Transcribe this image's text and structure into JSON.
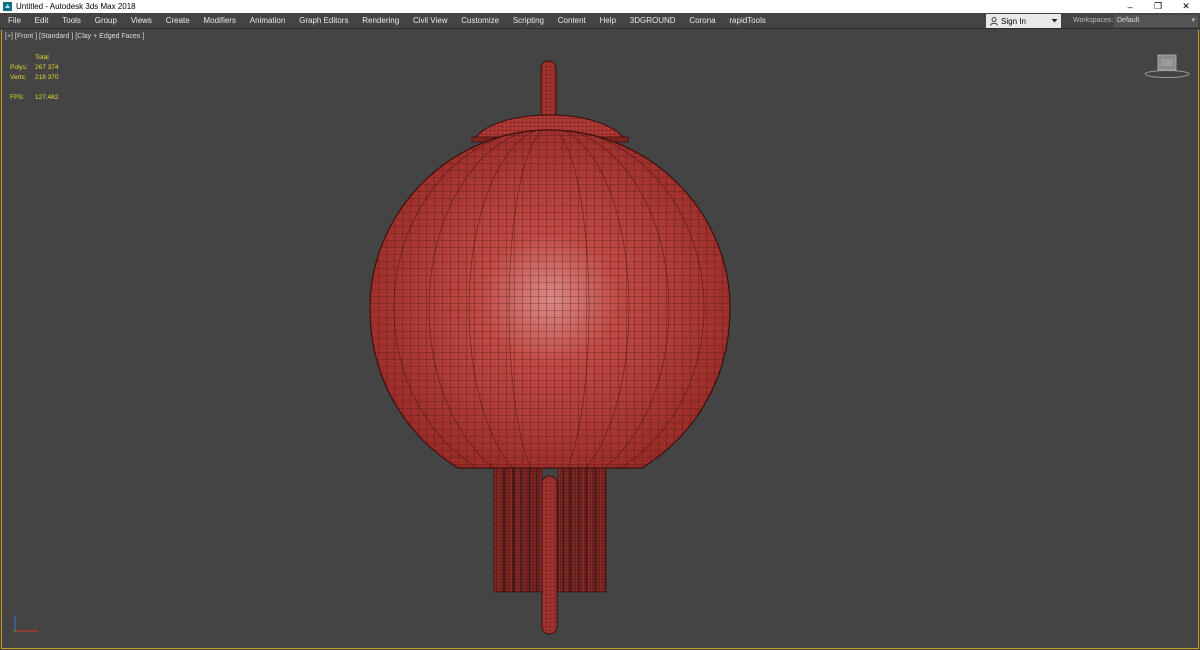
{
  "window": {
    "title": "Untitled - Autodesk 3ds Max 2018",
    "minimize_glyph": "–",
    "restore_glyph": "❐",
    "close_glyph": "✕"
  },
  "menu": {
    "items": [
      "File",
      "Edit",
      "Tools",
      "Group",
      "Views",
      "Create",
      "Modifiers",
      "Animation",
      "Graph Editors",
      "Rendering",
      "Civil View",
      "Customize",
      "Scripting",
      "Content",
      "Help",
      "3DGROUND",
      "Corona",
      "rapidTools"
    ]
  },
  "account": {
    "signin_label": "Sign In",
    "workspaces_label": "Workspaces:",
    "workspace_value": "Default"
  },
  "viewport": {
    "label": "[+] [Front ] [Standard ] [Clay + Edged Faces ]",
    "stats": {
      "header": "Total",
      "polys_label": "Polys:",
      "polys_value": "267 374",
      "verts_label": "Verts:",
      "verts_value": "218 370",
      "fps_label": "FPS:",
      "fps_value": "127,462"
    }
  },
  "colors": {
    "background": "#444444",
    "viewport_border": "#c9a227",
    "stats_text": "#e5dc2e",
    "model_fill": "#b83a35",
    "model_wire": "#3a0f0d"
  },
  "icons": {
    "app": "3ds-max-icon",
    "user": "user-icon",
    "dropdown": "dropdown-arrow-icon",
    "viewcube": "viewcube-icon",
    "axis": "axis-tripod-icon"
  }
}
